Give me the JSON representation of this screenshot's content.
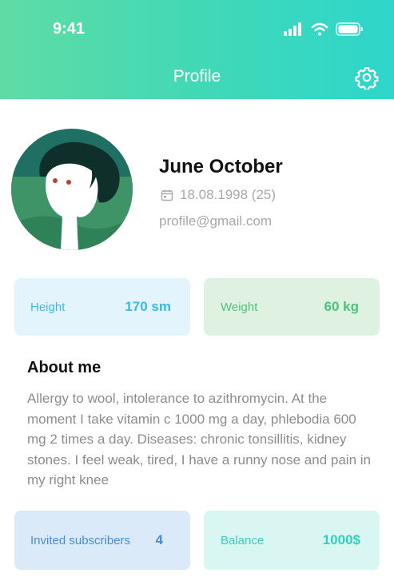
{
  "status_bar": {
    "time": "9:41",
    "icons": [
      "signal-icon",
      "wifi-icon",
      "battery-icon"
    ]
  },
  "header": {
    "title": "Profile",
    "settings_icon": "gear-icon"
  },
  "profile": {
    "name": "June October",
    "birth_date": "18.08.1998 (25)",
    "email": "profile@gmail.com",
    "calendar_icon": "calendar-icon"
  },
  "stats": {
    "height": {
      "label": "Height",
      "value": "170 sm"
    },
    "weight": {
      "label": "Weight",
      "value": "60 kg"
    }
  },
  "about": {
    "title": "About me",
    "text": "Allergy to wool, intolerance to azithromycin. At the moment I take vitamin c 1000 mg a day, phlebodia 600 mg 2 times a day. Diseases: chronic tonsillitis, kidney stones. I feel weak, tired, I have a runny nose and pain in my right knee"
  },
  "footer_cards": {
    "invited": {
      "label": "Invited subscribers",
      "value": "4"
    },
    "balance": {
      "label": "Balance",
      "value": "1000$"
    }
  },
  "colors": {
    "header_gradient_start": "#5fdca4",
    "header_gradient_end": "#2fd6cc",
    "height_card_bg": "#e3f4fc",
    "weight_card_bg": "#dff2e2",
    "invited_card_bg": "#dbeaf8",
    "balance_card_bg": "#daf6f2"
  }
}
